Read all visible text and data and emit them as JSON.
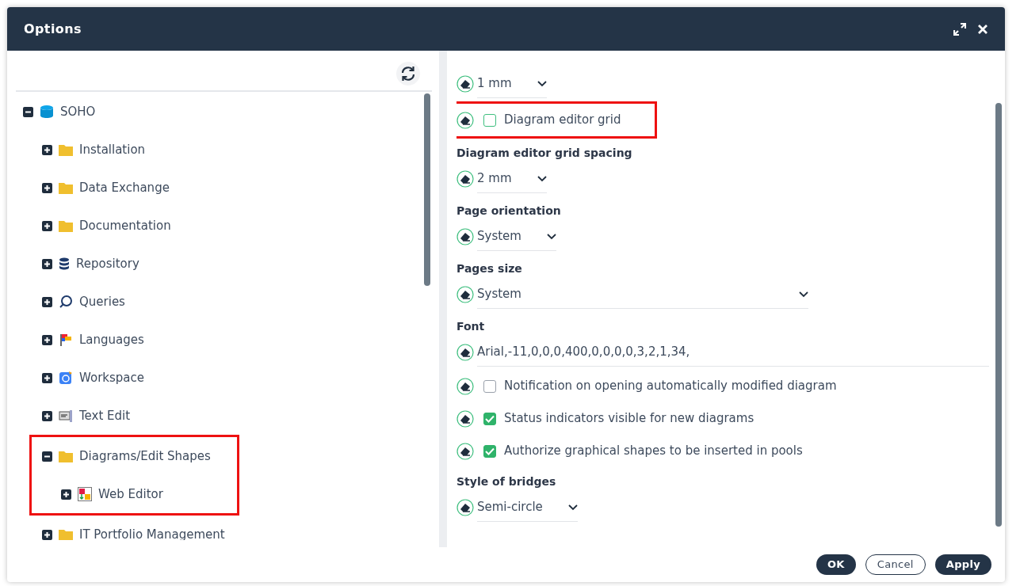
{
  "window": {
    "title": "Options"
  },
  "tree": {
    "items": [
      {
        "label": "SOHO",
        "kind": "cylinder",
        "expanded": true,
        "highlighted": false,
        "children": [
          {
            "label": "Installation",
            "kind": "folder",
            "expanded": false,
            "highlighted": false
          },
          {
            "label": "Data Exchange",
            "kind": "folder",
            "expanded": false,
            "highlighted": false
          },
          {
            "label": "Documentation",
            "kind": "folder",
            "expanded": false,
            "highlighted": false
          },
          {
            "label": "Repository",
            "kind": "database",
            "expanded": false,
            "highlighted": false
          },
          {
            "label": "Queries",
            "kind": "search",
            "expanded": false,
            "highlighted": false
          },
          {
            "label": "Languages",
            "kind": "flags",
            "expanded": false,
            "highlighted": false
          },
          {
            "label": "Workspace",
            "kind": "workspace",
            "expanded": false,
            "highlighted": false
          },
          {
            "label": "Text Edit",
            "kind": "text",
            "expanded": false,
            "highlighted": false
          },
          {
            "label": "Diagrams/Edit Shapes",
            "kind": "folder",
            "expanded": true,
            "highlighted": true,
            "children": [
              {
                "label": "Web Editor",
                "kind": "shapes",
                "expanded": false,
                "highlighted": false
              }
            ]
          },
          {
            "label": "IT Portfolio Management",
            "kind": "folder",
            "expanded": false,
            "highlighted": false
          }
        ]
      }
    ]
  },
  "settings": [
    {
      "kind": "select",
      "value": "1 mm",
      "wide": false
    },
    {
      "kind": "checkbox",
      "label": "Diagram editor grid",
      "checked": false,
      "highlighted": true
    },
    {
      "kind": "heading",
      "label": "Diagram editor grid spacing"
    },
    {
      "kind": "select",
      "value": "2 mm",
      "wide": false
    },
    {
      "kind": "heading",
      "label": "Page orientation"
    },
    {
      "kind": "select",
      "value": "System",
      "wide": false
    },
    {
      "kind": "heading",
      "label": "Pages size"
    },
    {
      "kind": "select",
      "value": "System",
      "wide": true
    },
    {
      "kind": "heading",
      "label": "Font"
    },
    {
      "kind": "text",
      "value": "Arial,-11,0,0,0,400,0,0,0,0,3,2,1,34,"
    },
    {
      "kind": "checkbox",
      "label": "Notification on opening automatically modified diagram",
      "checked": false,
      "highlighted": false
    },
    {
      "kind": "checkbox",
      "label": "Status indicators visible for new diagrams",
      "checked": true,
      "highlighted": false
    },
    {
      "kind": "checkbox",
      "label": "Authorize graphical shapes to be inserted in pools",
      "checked": true,
      "highlighted": false
    },
    {
      "kind": "heading",
      "label": "Style of bridges"
    },
    {
      "kind": "select",
      "value": "Semi-circle",
      "wide": false
    }
  ],
  "buttons": [
    {
      "label": "OK",
      "kind": "primary"
    },
    {
      "label": "Cancel",
      "kind": "secondary"
    },
    {
      "label": "Apply",
      "kind": "primary"
    }
  ]
}
